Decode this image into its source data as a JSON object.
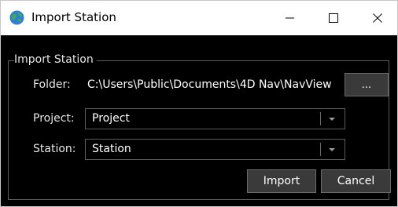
{
  "window": {
    "title": "Import Station"
  },
  "group": {
    "title": "Import Station"
  },
  "folder": {
    "label": "Folder:",
    "path": "C:\\Users\\Public\\Documents\\4D Nav\\NavView",
    "browse_label": "..."
  },
  "project": {
    "label": "Project:",
    "value": "Project"
  },
  "station": {
    "label": "Station:",
    "value": "Station"
  },
  "buttons": {
    "import_label": "Import",
    "cancel_label": "Cancel"
  },
  "colors": {
    "background": "#000000",
    "button": "#3a3a3a",
    "border": "#5c5c5c",
    "text": "#e6e6e6"
  }
}
